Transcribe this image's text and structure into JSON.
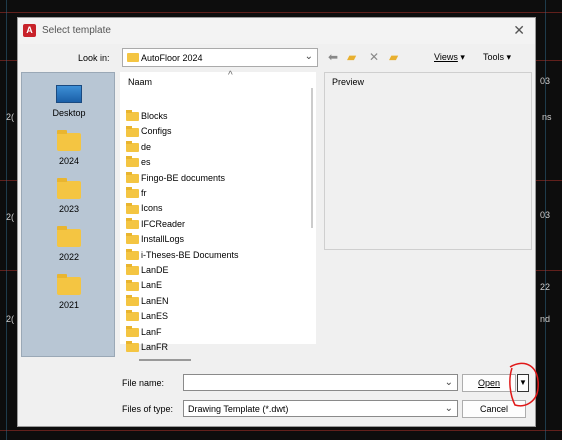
{
  "window": {
    "title": "Select template",
    "close_glyph": "✕"
  },
  "lookin": {
    "label": "Look in:",
    "value": "AutoFloor 2024"
  },
  "toolbar": {
    "back_icon": "back-arrow-icon",
    "up_icon": "up-folder-icon",
    "delete_icon": "delete-icon",
    "new_folder_icon": "new-folder-icon",
    "views_label": "Views",
    "tools_label": "Tools"
  },
  "places": [
    {
      "label": "Desktop",
      "icon": "desktop-icon"
    },
    {
      "label": "2024",
      "icon": "folder-icon"
    },
    {
      "label": "2023",
      "icon": "folder-icon"
    },
    {
      "label": "2022",
      "icon": "folder-icon"
    },
    {
      "label": "2021",
      "icon": "folder-icon"
    }
  ],
  "filelist": {
    "column_header": "Naam",
    "items": [
      "Blocks",
      "Configs",
      "de",
      "es",
      "Fingo-BE documents",
      "fr",
      "Icons",
      "IFCReader",
      "InstallLogs",
      "i-Theses-BE Documents",
      "LanDE",
      "LanE",
      "LanEN",
      "LanES",
      "LanF",
      "LanFR"
    ]
  },
  "preview": {
    "label": "Preview"
  },
  "filename": {
    "label": "File name:",
    "value": ""
  },
  "filetype": {
    "label": "Files of type:",
    "value": "Drawing Template (*.dwt)"
  },
  "buttons": {
    "open": "Open",
    "cancel": "Cancel"
  },
  "background_texts": [
    "03",
    "ns",
    "03",
    "2(",
    "2(",
    "22",
    "nd",
    "2("
  ],
  "colors": {
    "places_bg": "#b8c6d4",
    "folder": "#f4c542",
    "annotation": "#e01818"
  }
}
